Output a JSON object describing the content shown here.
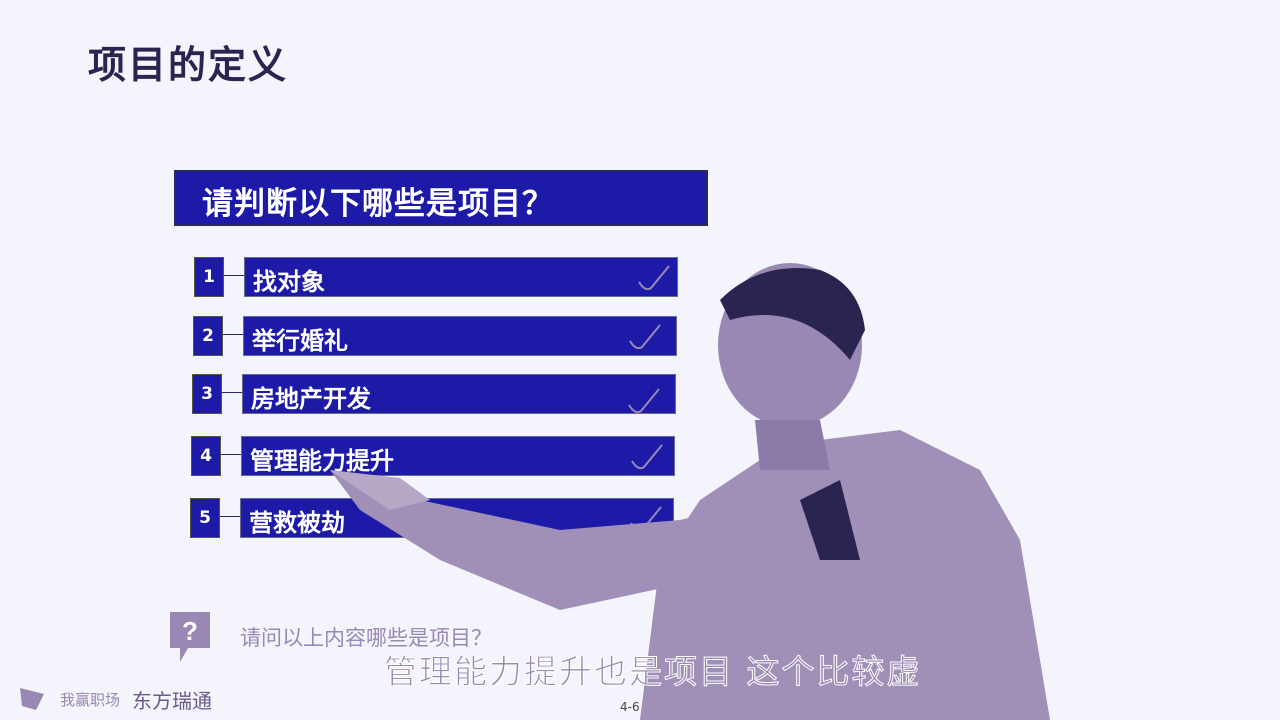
{
  "slide": {
    "title": "项目的定义",
    "question": "请判断以下哪些是项目？",
    "items": [
      {
        "number": "1",
        "label": "找对象",
        "checked": true
      },
      {
        "number": "2",
        "label": "举行婚礼",
        "checked": true
      },
      {
        "number": "3",
        "label": "房地产开发",
        "checked": true
      },
      {
        "number": "4",
        "label": "管理能力提升",
        "checked": true
      },
      {
        "number": "5",
        "label": "营救被劫",
        "checked": true
      }
    ],
    "footer_question": "请问以上内容哪些是项目？",
    "page_number": "4-6",
    "logos": [
      "我赢职场",
      "东方瑞通"
    ]
  },
  "subtitle": "管理能力提升也是项目 这个比较虚",
  "colors": {
    "bar": "#1e1aa8",
    "title": "#2a2550",
    "accent": "#9a88b4",
    "background": "#f4f4fc"
  }
}
